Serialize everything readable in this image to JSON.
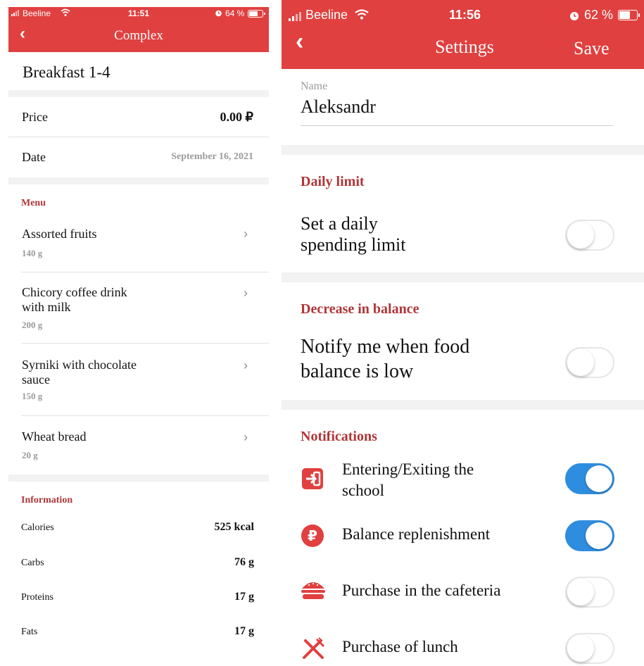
{
  "left": {
    "status": {
      "carrier": "Beeline",
      "time": "11:51",
      "battery": "64 %",
      "battery_level": 0.64
    },
    "header": {
      "title": "Complex"
    },
    "complex_name": "Breakfast 1-4",
    "price": {
      "label": "Price",
      "value": "0.00 ₽"
    },
    "date": {
      "label": "Date",
      "value": "September 16, 2021"
    },
    "menu": {
      "heading": "Menu",
      "items": [
        {
          "name_line1": "Assorted fruits",
          "name_line2": "",
          "weight": "140 g"
        },
        {
          "name_line1": "Chicory coffee drink",
          "name_line2": "with milk",
          "weight": "200 g"
        },
        {
          "name_line1": "Syrniki with chocolate",
          "name_line2": "sauce",
          "weight": "150 g"
        },
        {
          "name_line1": "Wheat bread",
          "name_line2": "",
          "weight": "20 g"
        }
      ]
    },
    "information": {
      "heading": "Information",
      "rows": [
        {
          "label": "Calories",
          "value": "525 kcal"
        },
        {
          "label": "Carbs",
          "value": "76 g"
        },
        {
          "label": "Proteins",
          "value": "17 g"
        },
        {
          "label": "Fats",
          "value": "17 g"
        }
      ]
    }
  },
  "right": {
    "status": {
      "carrier": "Beeline",
      "time": "11:56",
      "battery": "62 %",
      "battery_level": 0.62
    },
    "header": {
      "title": "Settings",
      "save": "Save"
    },
    "name": {
      "label": "Name",
      "value": "Aleksandr"
    },
    "daily_limit": {
      "heading": "Daily limit",
      "line1": "Set a daily",
      "line2": "spending limit",
      "enabled": false
    },
    "decrease_balance": {
      "heading": "Decrease in balance",
      "line1": "Notify me when food",
      "line2": "balance is low",
      "enabled": false
    },
    "notifications": {
      "heading": "Notifications",
      "items": [
        {
          "line1": "Entering/Exiting the",
          "line2": "school",
          "icon": "enter-exit-icon",
          "enabled": true
        },
        {
          "line1": "Balance replenishment",
          "line2": "",
          "icon": "ruble-icon",
          "enabled": true
        },
        {
          "line1": "Purchase in the cafeteria",
          "line2": "",
          "icon": "burger-icon",
          "enabled": false
        },
        {
          "line1": "Purchase of lunch",
          "line2": "",
          "icon": "cutlery-icon",
          "enabled": false
        }
      ]
    },
    "colors": {
      "header": "#e0403f",
      "section_heading": "#b03638",
      "toggle_on": "#2f8ddf"
    }
  }
}
